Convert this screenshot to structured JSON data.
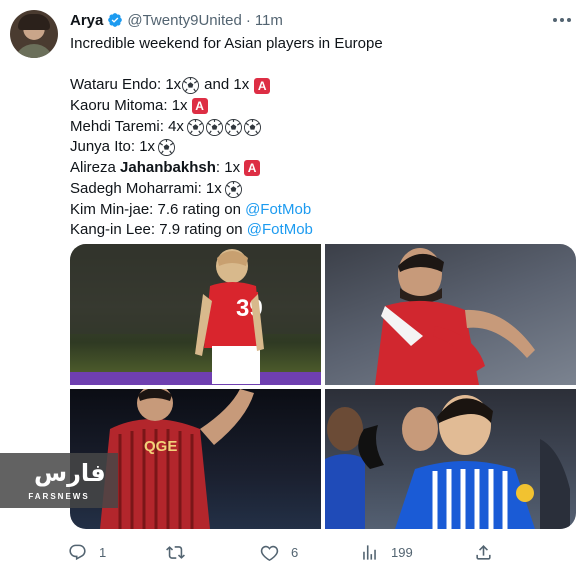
{
  "tweet": {
    "author": {
      "name": "Arya",
      "handle": "@Twenty9United",
      "separator": "·",
      "time": "11m",
      "verified": true
    },
    "lines": [
      {
        "type": "text",
        "text": "Incredible weekend for Asian players in Europe"
      },
      {
        "type": "blank"
      },
      {
        "prefix": "Wataru Endo: 1x",
        "mid": "and 1x"
      },
      {
        "prefix": "Kaoru Mitoma: 1x"
      },
      {
        "prefix": "Mehdi Taremi: 4x"
      },
      {
        "prefix": "Junya Ito: 1x"
      },
      {
        "prefix_a": "Alireza ",
        "prefix_b": "Jahanbakhsh",
        "prefix_c": ": 1x"
      },
      {
        "prefix": "Sadegh Moharrami: 1x"
      },
      {
        "prefix": "Kim Min-jae: 7.6 rating on ",
        "link": "@FotMob"
      },
      {
        "prefix": "Kang-in Lee: 7.9 rating on ",
        "link": "@FotMob"
      }
    ],
    "assist_letter": "A",
    "photos": [
      {
        "kit_number": "39"
      },
      {},
      {},
      {}
    ],
    "watermark": {
      "logo": "فارس",
      "text": "FARSNEWS"
    },
    "actions": {
      "reply_count": "1",
      "retweet_count": "",
      "like_count": "6",
      "views_count": "199"
    },
    "icons": [
      "verified-badge-icon",
      "soccer-ball-icon",
      "assist-icon",
      "more-icon",
      "reply-icon",
      "retweet-icon",
      "like-icon",
      "views-icon",
      "share-icon"
    ],
    "colors": {
      "link": "#1d9bf0",
      "verified": "#1d9bf0",
      "assist": "#dd2e44",
      "muted": "#536471"
    }
  }
}
